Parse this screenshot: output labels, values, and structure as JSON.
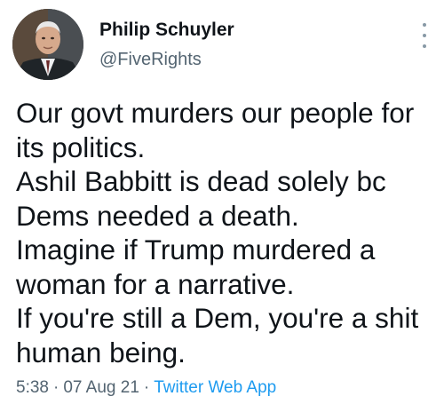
{
  "author": {
    "name": "Philip Schuyler",
    "handle": "@FiveRights"
  },
  "tweet": {
    "lines": [
      "Our govt murders our people for",
      "its politics.",
      "Ashil Babbitt is dead solely bc",
      "Dems needed a death.",
      "Imagine if Trump murdered a",
      "woman for a narrative.",
      "If you're still a Dem, you're a shit",
      "human being."
    ],
    "time": "5:38",
    "date": "07 Aug 21",
    "separator": "·",
    "source": "Twitter Web App"
  },
  "icons": {
    "more": "more-vertical-icon"
  },
  "colors": {
    "text": "#0f1419",
    "muted": "#536471",
    "link": "#1d9bf0",
    "background": "#ffffff"
  }
}
